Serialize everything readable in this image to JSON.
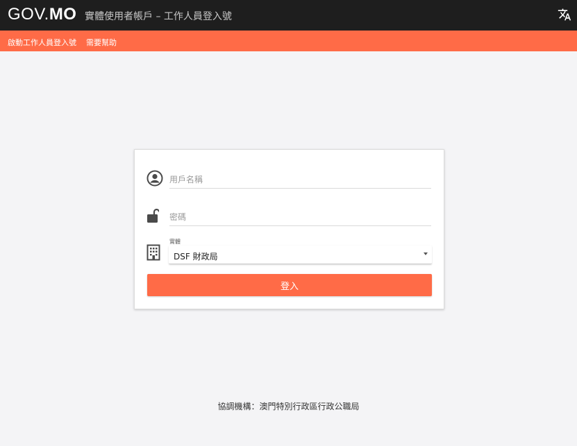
{
  "header": {
    "logo_gov": "GOV.",
    "logo_mo": "MO",
    "title": "實體使用者帳戶 – 工作人員登入號",
    "language_icon": "translate-icon"
  },
  "subnav": {
    "items": [
      {
        "label": "啟動工作人員登入號"
      },
      {
        "label": "需要幫助"
      }
    ]
  },
  "login": {
    "username_placeholder": "用戶名稱",
    "password_placeholder": "密碼",
    "entity_label": "實體",
    "entity_value": "DSF 財政局",
    "submit_label": "登入",
    "icons": {
      "username": "user-circle-icon",
      "password": "unlock-icon",
      "entity": "building-icon"
    }
  },
  "footer": {
    "text": "協調機構：澳門特別行政區行政公職局"
  },
  "colors": {
    "topbar": "#1e1e1e",
    "accent": "#ff6b47",
    "background": "#f4f4f6"
  }
}
